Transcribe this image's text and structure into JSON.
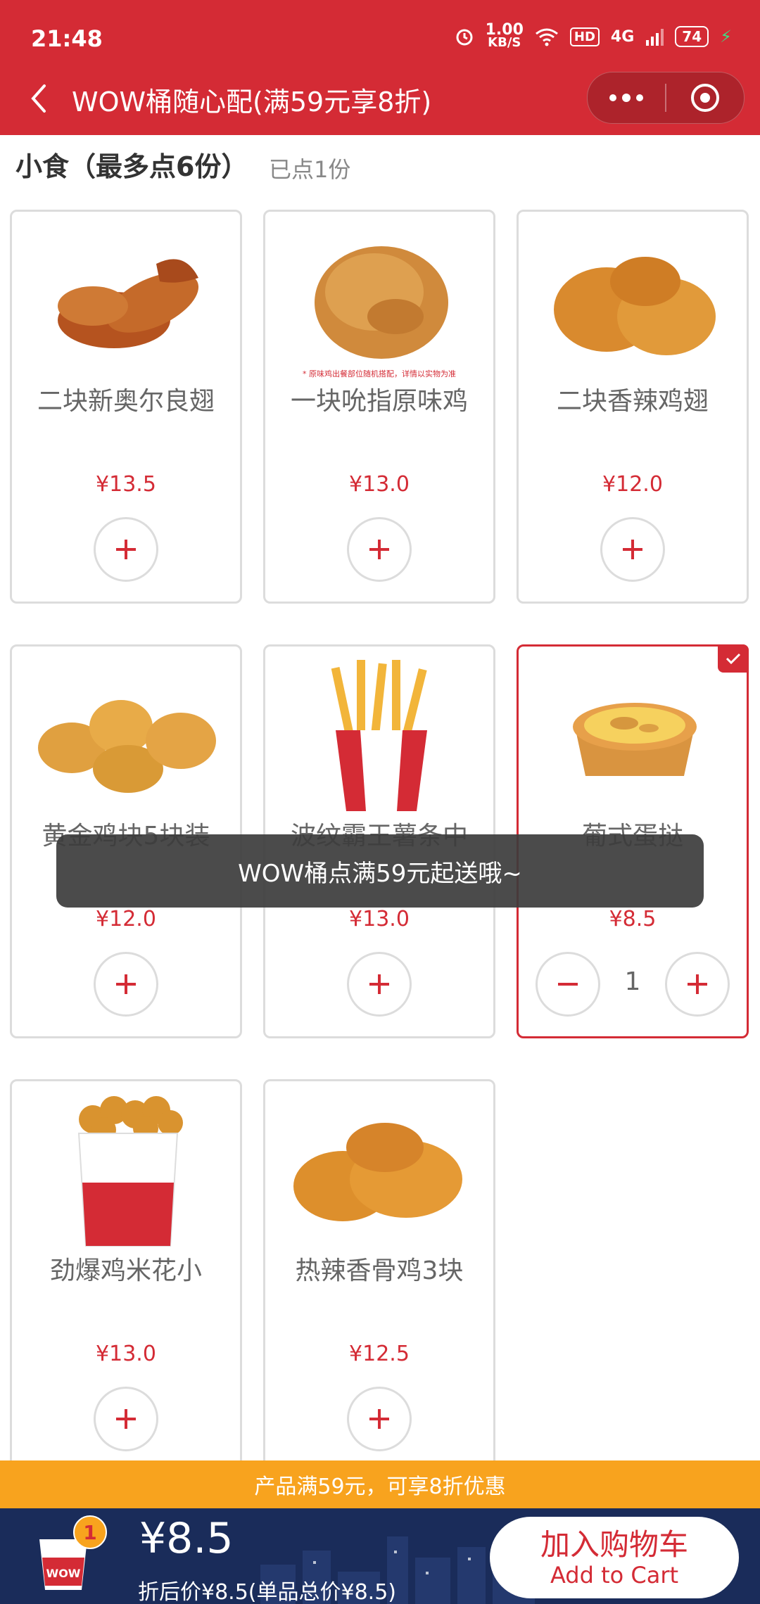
{
  "status_bar": {
    "time": "21:48",
    "speed_value": "1.00",
    "speed_unit": "KB/S",
    "hd_label": "HD",
    "network": "4G",
    "battery": "74"
  },
  "nav": {
    "title": "WOW桶随心配(满59元享8折)"
  },
  "section": {
    "title": "小食（最多点6份）",
    "count": "已点1份"
  },
  "products": [
    {
      "name": "二块新奥尔良翅",
      "price": "¥13.5",
      "selected": false
    },
    {
      "name": "一块吮指原味鸡",
      "price": "¥13.0",
      "selected": false,
      "note": "* 原味鸡出餐部位随机搭配，详情以实物为准"
    },
    {
      "name": "二块香辣鸡翅",
      "price": "¥12.0",
      "selected": false
    },
    {
      "name": "黄金鸡块5块装",
      "price": "¥12.0",
      "selected": false
    },
    {
      "name": "波纹霸王薯条中",
      "price": "¥13.0",
      "selected": false
    },
    {
      "name": "葡式蛋挞",
      "price": "¥8.5",
      "selected": true,
      "quantity": "1"
    },
    {
      "name": "劲爆鸡米花小",
      "price": "¥13.0",
      "selected": false
    },
    {
      "name": "热辣香骨鸡3块",
      "price": "¥12.5",
      "selected": false
    }
  ],
  "toast": "WOW桶点满59元起送哦~",
  "promo": "产品满59元，可享8折优惠",
  "cart": {
    "badge": "1",
    "bucket_label": "WOW",
    "total": "¥8.5",
    "detail": "折后价¥8.5(单品总价¥8.5)",
    "button_zh": "加入购物车",
    "button_en": "Add to Cart"
  },
  "colors": {
    "brand_red": "#d42b35",
    "promo_orange": "#f8a31e",
    "bottom_navy": "#1a2c5a"
  }
}
